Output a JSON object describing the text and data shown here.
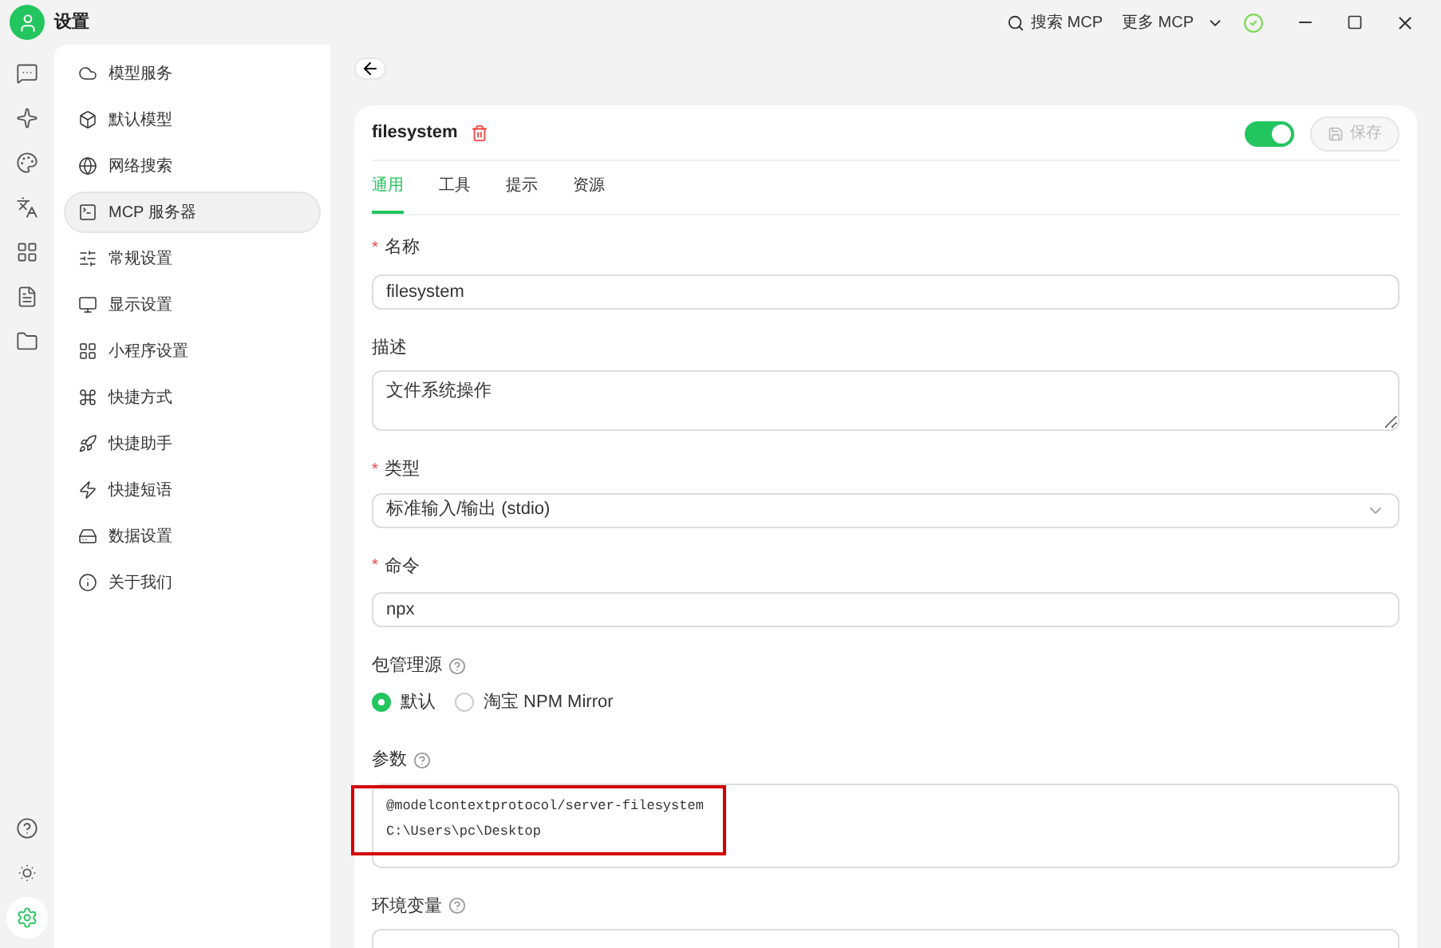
{
  "window": {
    "title": "设置"
  },
  "header_actions": [
    {
      "kind": "search",
      "label": "搜索 MCP"
    },
    {
      "kind": "dropdown",
      "label": "更多 MCP"
    }
  ],
  "rail": {
    "top_items": [
      {
        "selected": false
      },
      {
        "selected": false
      },
      {
        "selected": false
      },
      {
        "selected": false
      },
      {
        "selected": false
      },
      {
        "selected": false
      },
      {
        "selected": false
      }
    ],
    "bottom_items": [
      {
        "selected": false
      },
      {
        "selected": false
      },
      {
        "selected": true
      }
    ]
  },
  "sidebar": {
    "items": [
      {
        "label": "模型服务",
        "selected": false
      },
      {
        "label": "默认模型",
        "selected": false
      },
      {
        "label": "网络搜索",
        "selected": false
      },
      {
        "label": "MCP 服务器",
        "selected": true
      },
      {
        "label": "常规设置",
        "selected": false
      },
      {
        "label": "显示设置",
        "selected": false
      },
      {
        "label": "小程序设置",
        "selected": false
      },
      {
        "label": "快捷方式",
        "selected": false
      },
      {
        "label": "快捷助手",
        "selected": false
      },
      {
        "label": "快捷短语",
        "selected": false
      },
      {
        "label": "数据设置",
        "selected": false
      },
      {
        "label": "关于我们",
        "selected": false
      }
    ]
  },
  "server": {
    "name": "filesystem",
    "enabled": true,
    "save_button": {
      "label": "保存",
      "disabled": true
    },
    "tabs": [
      {
        "label": "通用",
        "selected": true
      },
      {
        "label": "工具",
        "selected": false
      },
      {
        "label": "提示",
        "selected": false
      },
      {
        "label": "资源",
        "selected": false
      }
    ],
    "fields": [
      {
        "kind": "text",
        "label": "名称",
        "required_mark": "*",
        "value": "filesystem"
      },
      {
        "kind": "textarea",
        "label": "描述",
        "value": "文件系统操作"
      },
      {
        "kind": "select",
        "label": "类型",
        "required_mark": "*",
        "value": "标准输入/输出 (stdio)"
      },
      {
        "kind": "text",
        "label": "命令",
        "required_mark": "*",
        "value": "npx"
      },
      {
        "kind": "radio",
        "label": "包管理源",
        "help": true,
        "options": [
          {
            "label": "默认",
            "selected": true
          },
          {
            "label": "淘宝 NPM Mirror",
            "selected": false
          }
        ]
      },
      {
        "kind": "code",
        "label": "参数",
        "help": true,
        "highlighted": true,
        "lines": [
          "@modelcontextprotocol/server-filesystem",
          "C:\\Users\\pc\\Desktop"
        ]
      },
      {
        "kind": "partial",
        "label": "环境变量",
        "help": true
      }
    ]
  }
}
